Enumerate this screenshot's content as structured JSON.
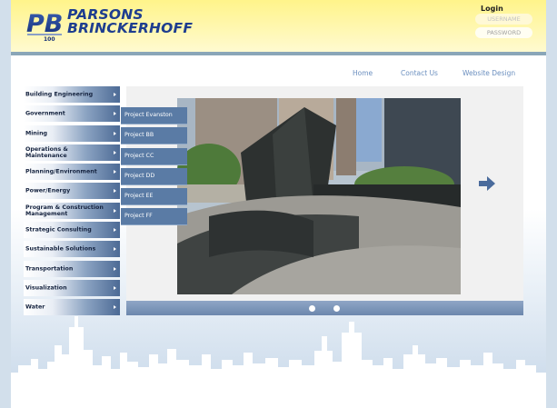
{
  "brand": {
    "line1": "PARSONS",
    "line2": "BRINCKERHOFF",
    "mark_letters": "PB",
    "mark_small": "100"
  },
  "login": {
    "title": "Login",
    "username_placeholder": "USERNAME",
    "password_placeholder": "PASSWORD"
  },
  "topnav": {
    "items": [
      "Home",
      "Contact Us",
      "Website Design"
    ]
  },
  "sidebar": {
    "items": [
      "Building Engineering",
      "Government",
      "Mining",
      "Operations & Maintenance",
      "Planning/Environment",
      "Power/Energy",
      "Program & Construction Management",
      "Strategic Consulting",
      "Sustainable Solutions",
      "Transportation",
      "Visualization",
      "Water"
    ]
  },
  "submenu": {
    "items": [
      "Project Evanston",
      "Project BB",
      "Project CC",
      "Project DD",
      "Project EE",
      "Project FF"
    ]
  },
  "colors": {
    "header_yellow": "#fff48a",
    "brand_blue": "#1e3d8f",
    "nav_blue": "#5a7ba5",
    "link_blue": "#6b8fbf"
  },
  "icons": {
    "next": "right-arrow-icon",
    "skyline": "city-skyline"
  }
}
